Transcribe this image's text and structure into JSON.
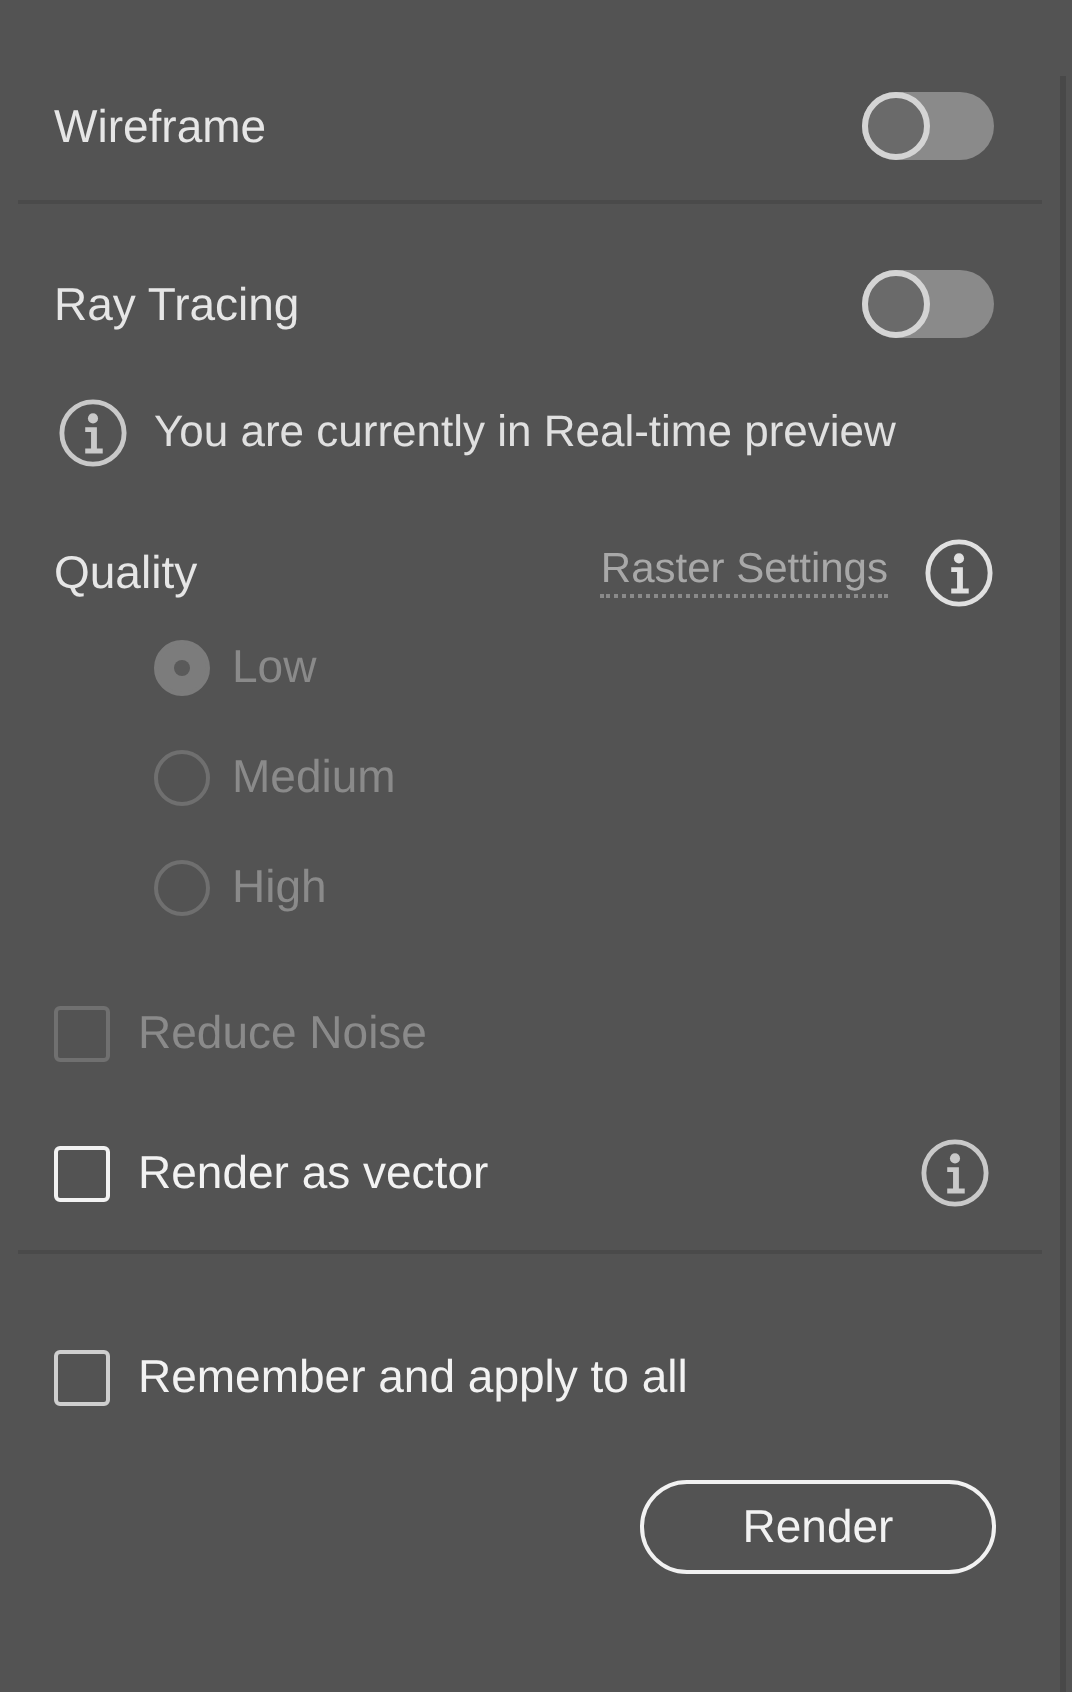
{
  "toggles": [
    {
      "label": "Wireframe",
      "on": false
    },
    {
      "label": "Ray Tracing",
      "on": false
    }
  ],
  "info_note": "You are currently in Real-time preview",
  "quality": {
    "label": "Quality",
    "link": "Raster Settings",
    "disabled": true,
    "options": [
      {
        "label": "Low",
        "selected": true
      },
      {
        "label": "Medium",
        "selected": false
      },
      {
        "label": "High",
        "selected": false
      }
    ]
  },
  "reduce_noise": {
    "label": "Reduce Noise",
    "checked": false,
    "disabled": true
  },
  "render_as_vector": {
    "label": "Render as vector",
    "checked": false,
    "disabled": false
  },
  "remember": {
    "label": "Remember and apply to all",
    "checked": false,
    "disabled": false
  },
  "button": "Render"
}
